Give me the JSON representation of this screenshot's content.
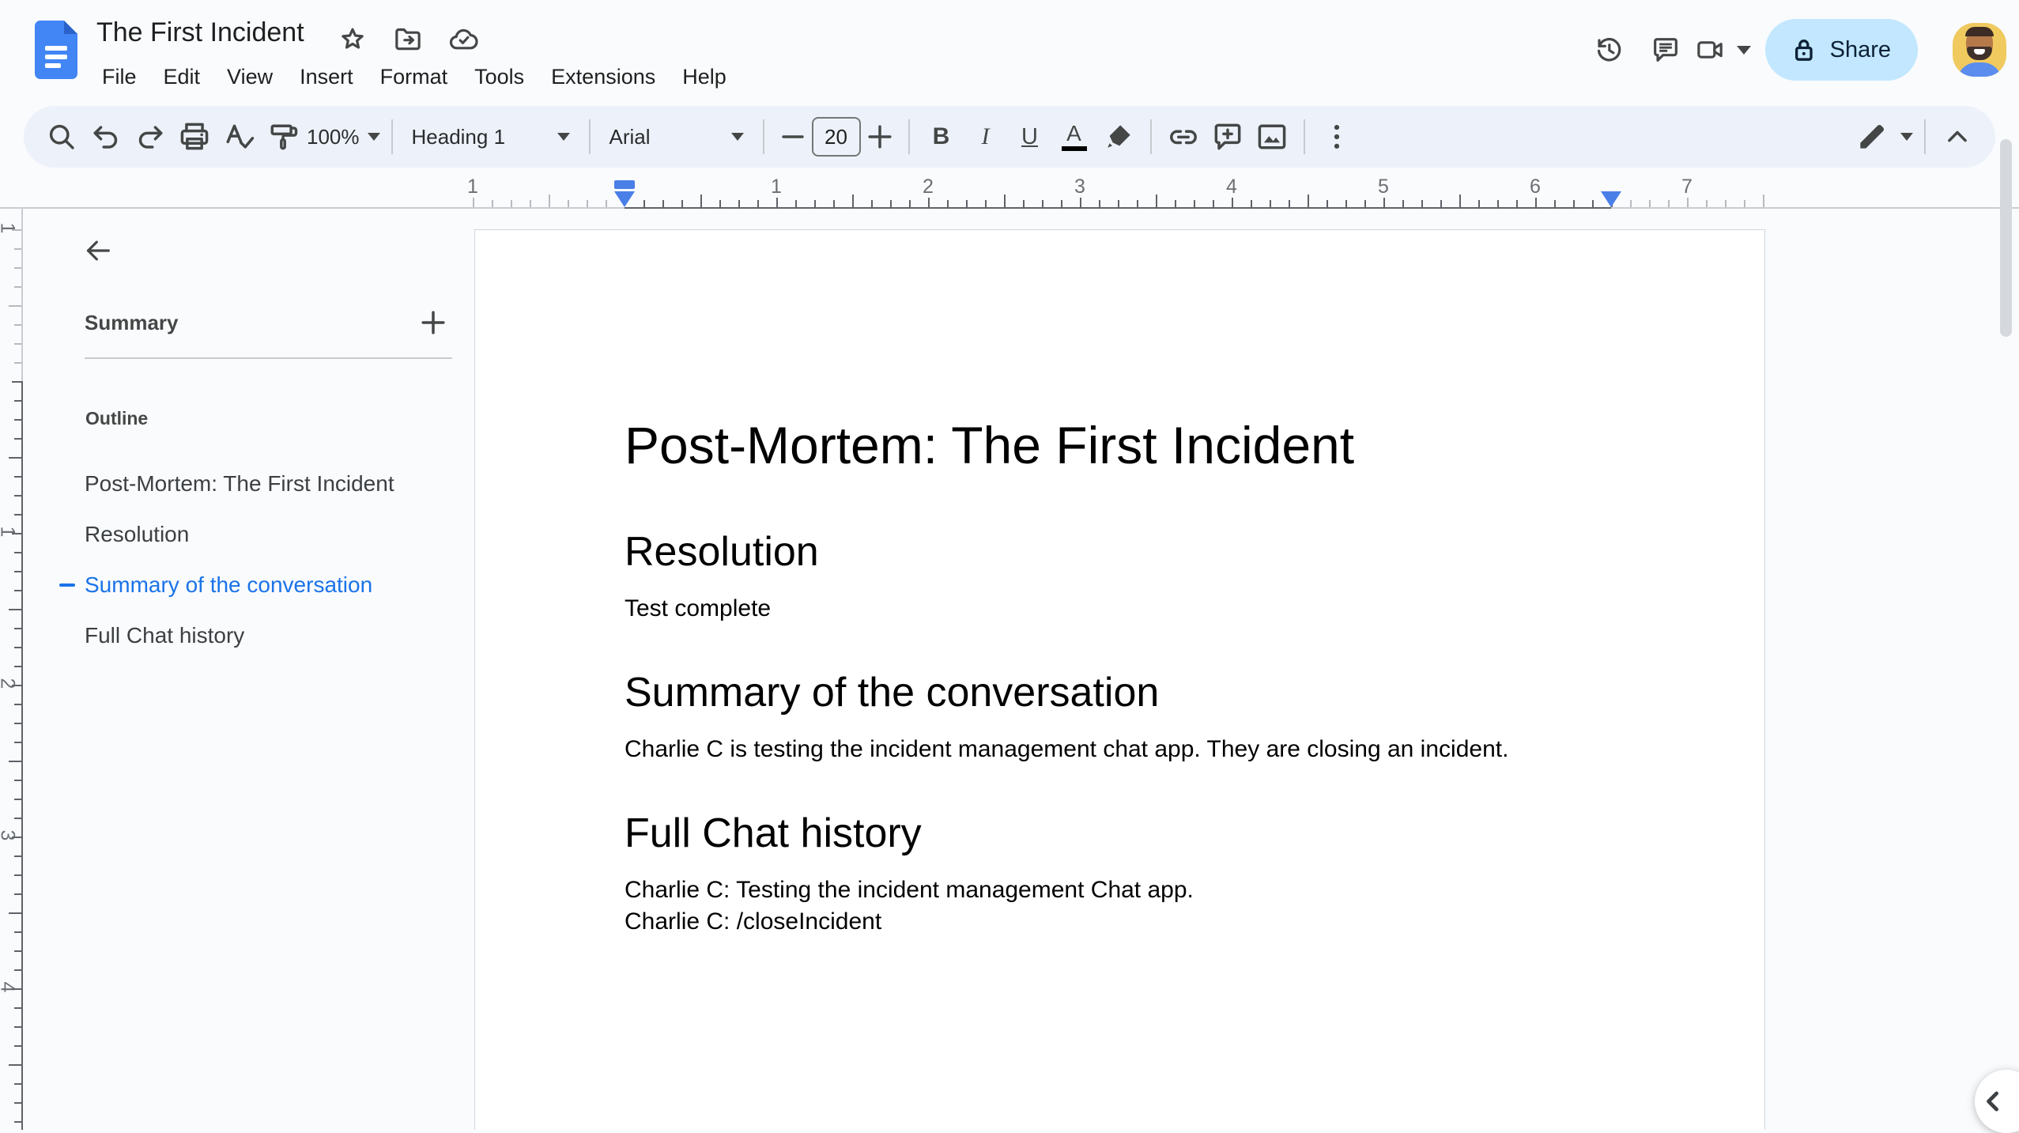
{
  "app": {
    "title": "The First Incident"
  },
  "menu": {
    "items": [
      "File",
      "Edit",
      "View",
      "Insert",
      "Format",
      "Tools",
      "Extensions",
      "Help"
    ]
  },
  "header": {
    "share_label": "Share",
    "icons": [
      "star-icon",
      "move-to-folder-icon",
      "cloud-saved-icon",
      "version-history-icon",
      "comments-icon",
      "join-call-icon"
    ]
  },
  "toolbar": {
    "zoom_value": "100%",
    "style_value": "Heading 1",
    "font_value": "Arial",
    "size_value": "20"
  },
  "ruler": {
    "h_labels": [
      "1",
      "1",
      "2",
      "3",
      "4",
      "5",
      "6",
      "7"
    ],
    "v_labels": [
      "1",
      "1",
      "2",
      "3",
      "4"
    ]
  },
  "sidebar": {
    "summary_label": "Summary",
    "outline_label": "Outline",
    "outline_items": [
      {
        "label": "Post-Mortem: The First Incident",
        "active": false
      },
      {
        "label": "Resolution",
        "active": false
      },
      {
        "label": "Summary of the conversation",
        "active": true
      },
      {
        "label": "Full Chat history",
        "active": false
      }
    ]
  },
  "document": {
    "title": "Post-Mortem: The First Incident",
    "sections": [
      {
        "heading": "Resolution",
        "paragraphs": [
          "Test complete"
        ]
      },
      {
        "heading": "Summary of the conversation",
        "paragraphs": [
          "Charlie C is testing the incident management chat app. They are closing an incident."
        ]
      },
      {
        "heading": "Full Chat history",
        "paragraphs": [
          "Charlie C: Testing the incident management Chat app.",
          "Charlie C: /closeIncident"
        ]
      }
    ]
  },
  "colors": {
    "accent_blue": "#1a73e8",
    "share_bg": "#c2e7ff",
    "share_text": "#0d2136",
    "toolbar_bg": "#edf2fa",
    "ruler_marker_blue": "#4a7fe8",
    "docs_logo_blue": "#4285f4"
  }
}
